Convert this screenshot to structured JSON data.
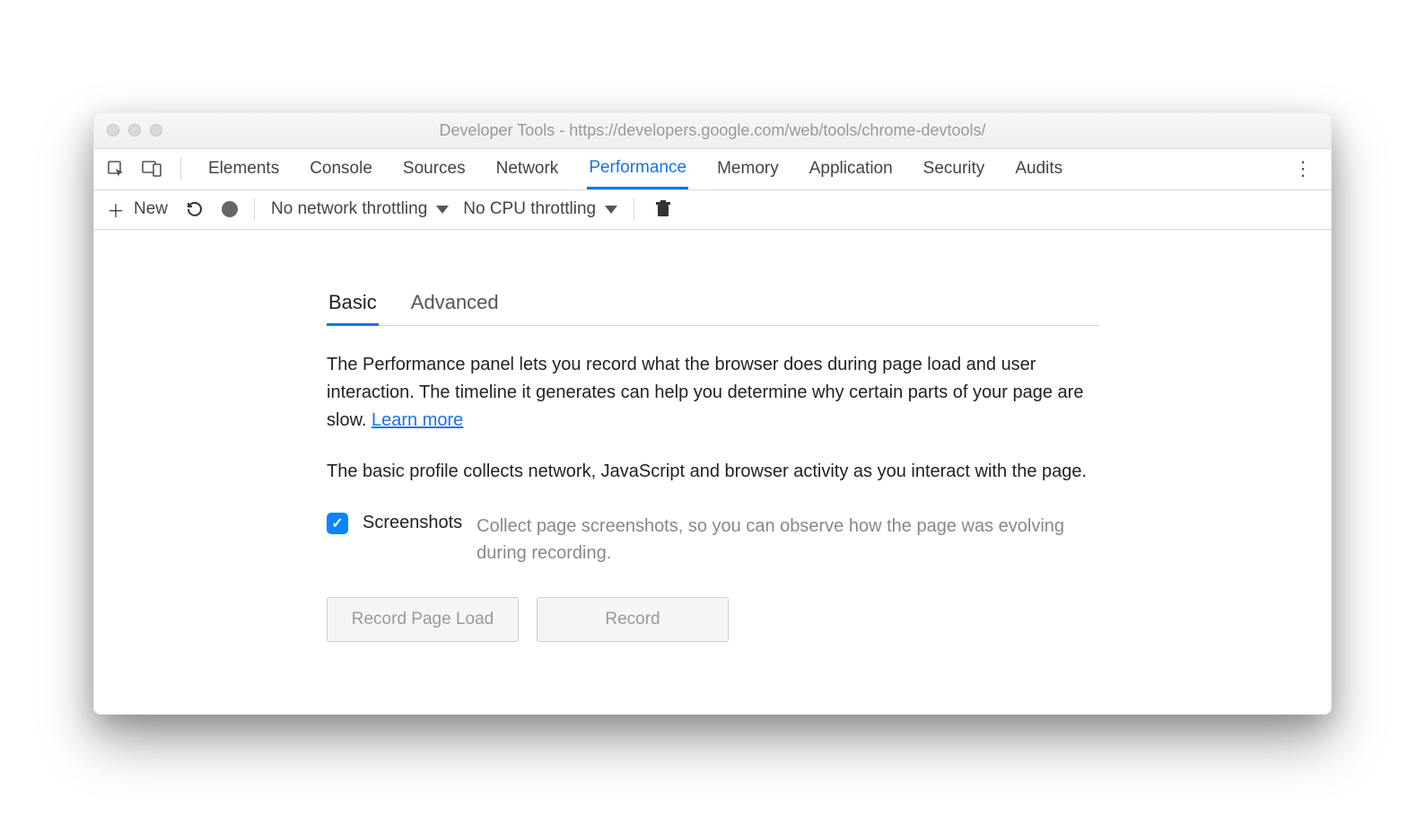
{
  "window": {
    "title": "Developer Tools - https://developers.google.com/web/tools/chrome-devtools/"
  },
  "tabbar": {
    "tabs": [
      "Elements",
      "Console",
      "Sources",
      "Network",
      "Performance",
      "Memory",
      "Application",
      "Security",
      "Audits"
    ],
    "active_index": 4
  },
  "toolbar": {
    "new_label": "New",
    "network_throttling": "No network throttling",
    "cpu_throttling": "No CPU throttling"
  },
  "subtab": {
    "items": [
      "Basic",
      "Advanced"
    ],
    "active_index": 0
  },
  "panel": {
    "description": "The Performance panel lets you record what the browser does during page load and user interaction. The timeline it generates can help you determine why certain parts of your page are slow.  ",
    "learn_more": "Learn more",
    "basic_note": "The basic profile collects network, JavaScript and browser activity as you interact with the page.",
    "screenshot_label": "Screenshots",
    "screenshot_help": "Collect page screenshots, so you can observe how the page was evolving during recording.",
    "screenshot_checked": true,
    "buttons": {
      "record_page_load": "Record Page Load",
      "record": "Record"
    }
  }
}
